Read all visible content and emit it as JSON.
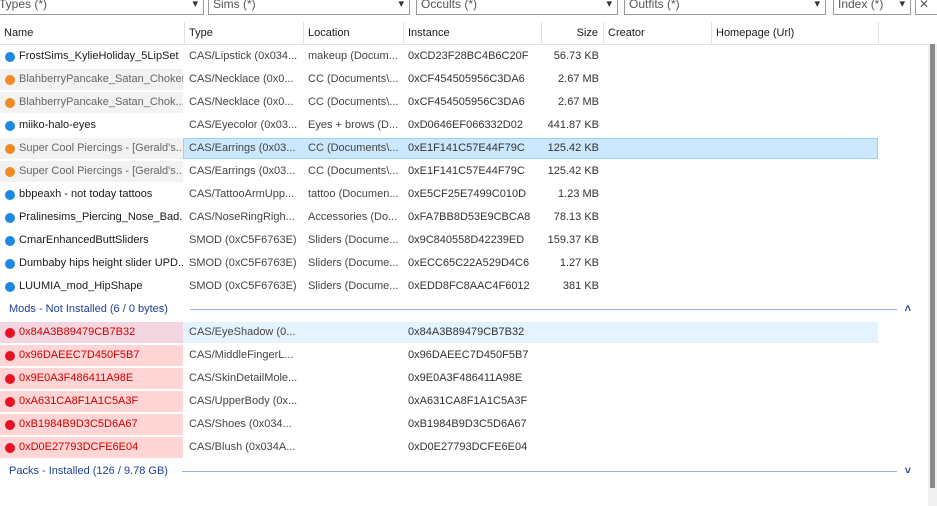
{
  "filters": [
    {
      "label": "Types (*)"
    },
    {
      "label": "Sims (*)"
    },
    {
      "label": "Occults (*)"
    },
    {
      "label": "Outfits (*)"
    },
    {
      "label": "Index (*)"
    }
  ],
  "columns": {
    "name": "Name",
    "type": "Type",
    "location": "Location",
    "instance": "Instance",
    "size": "Size",
    "creator": "Creator",
    "homepage": "Homepage (Url)"
  },
  "colors": {
    "blue": "#1e88e5",
    "orange": "#f08a24",
    "red": "#e81123",
    "red_row": "#ffd5d5",
    "red_text": "#d10000"
  },
  "installed_rows": [
    {
      "dot": "blue",
      "name": "FrostSims_KylieHoliday_5LipSet",
      "type": "CAS/Lipstick (0x034...",
      "location": "makeup (Docum...",
      "instance": "0xCD23F28BC4B6C20F",
      "size": "56.73 KB"
    },
    {
      "dot": "orange",
      "name": "BlahberryPancake_Satan_Choker",
      "type": "CAS/Necklace (0x0...",
      "location": "CC (Documents\\...",
      "instance": "0xCF454505956C3DA6",
      "size": "2.67 MB",
      "faded": true
    },
    {
      "dot": "orange",
      "name": "BlahberryPancake_Satan_Chok...",
      "type": "CAS/Necklace (0x0...",
      "location": "CC (Documents\\...",
      "instance": "0xCF454505956C3DA6",
      "size": "2.67 MB",
      "faded": true
    },
    {
      "dot": "blue",
      "name": "miiko-halo-eyes",
      "type": "CAS/Eyecolor (0x03...",
      "location": "Eyes + brows (D...",
      "instance": "0xD0646EF066332D02",
      "size": "441.87 KB"
    },
    {
      "dot": "orange",
      "name": "Super Cool Piercings - [Gerald's...",
      "type": "CAS/Earrings (0x03...",
      "location": "CC (Documents\\...",
      "instance": "0xE1F141C57E44F79C",
      "size": "125.42 KB",
      "faded": true,
      "selected": true
    },
    {
      "dot": "orange",
      "name": "Super Cool Piercings - [Gerald's...",
      "type": "CAS/Earrings (0x03...",
      "location": "CC (Documents\\...",
      "instance": "0xE1F141C57E44F79C",
      "size": "125.42 KB",
      "faded": true
    },
    {
      "dot": "blue",
      "name": "bbpeaxh - not today tattoos",
      "type": "CAS/TattooArmUpp...",
      "location": "tattoo (Documen...",
      "instance": "0xE5CF25E7499C010D",
      "size": "1.23 MB"
    },
    {
      "dot": "blue",
      "name": "Pralinesims_Piercing_Nose_Bad...",
      "type": "CAS/NoseRingRigh...",
      "location": "Accessories (Do...",
      "instance": "0xFA7BB8D53E9CBCA8",
      "size": "78.13 KB"
    },
    {
      "dot": "blue",
      "name": "CmarEnhancedButtSliders",
      "type": "SMOD (0xC5F6763E)",
      "location": "Sliders (Docume...",
      "instance": "0x9C840558D42239ED",
      "size": "159.37 KB"
    },
    {
      "dot": "blue",
      "name": "Dumbaby hips height slider UPD...",
      "type": "SMOD (0xC5F6763E)",
      "location": "Sliders (Docume...",
      "instance": "0xECC65C22A529D4C6",
      "size": "1.27 KB"
    },
    {
      "dot": "blue",
      "name": "LUUMIA_mod_HipShape",
      "type": "SMOD (0xC5F6763E)",
      "location": "Sliders (Docume...",
      "instance": "0xEDD8FC8AAC4F6012",
      "size": "381 KB"
    }
  ],
  "group_not_installed": {
    "label": "Mods - Not Installed   (6 / 0 bytes)",
    "chevron": "˄"
  },
  "not_installed_rows": [
    {
      "name": "0x84A3B89479CB7B32",
      "type": "CAS/EyeShadow (0...",
      "instance": "0x84A3B89479CB7B32",
      "selected_soft": true
    },
    {
      "name": "0x96DAEEC7D450F5B7",
      "type": "CAS/MiddleFingerL...",
      "instance": "0x96DAEEC7D450F5B7"
    },
    {
      "name": "0x9E0A3F486411A98E",
      "type": "CAS/SkinDetailMole...",
      "instance": "0x9E0A3F486411A98E"
    },
    {
      "name": "0xA631CA8F1A1C5A3F",
      "type": "CAS/UpperBody (0x...",
      "instance": "0xA631CA8F1A1C5A3F"
    },
    {
      "name": "0xB1984B9D3C5D6A67",
      "type": "CAS/Shoes (0x034...",
      "instance": "0xB1984B9D3C5D6A67"
    },
    {
      "name": "0xD0E27793DCFE6E04",
      "type": "CAS/Blush (0x034A...",
      "instance": "0xD0E27793DCFE6E04"
    }
  ],
  "group_packs": {
    "label": "Packs - Installed   (126 / 9.78 GB)",
    "chevron": "˅"
  }
}
